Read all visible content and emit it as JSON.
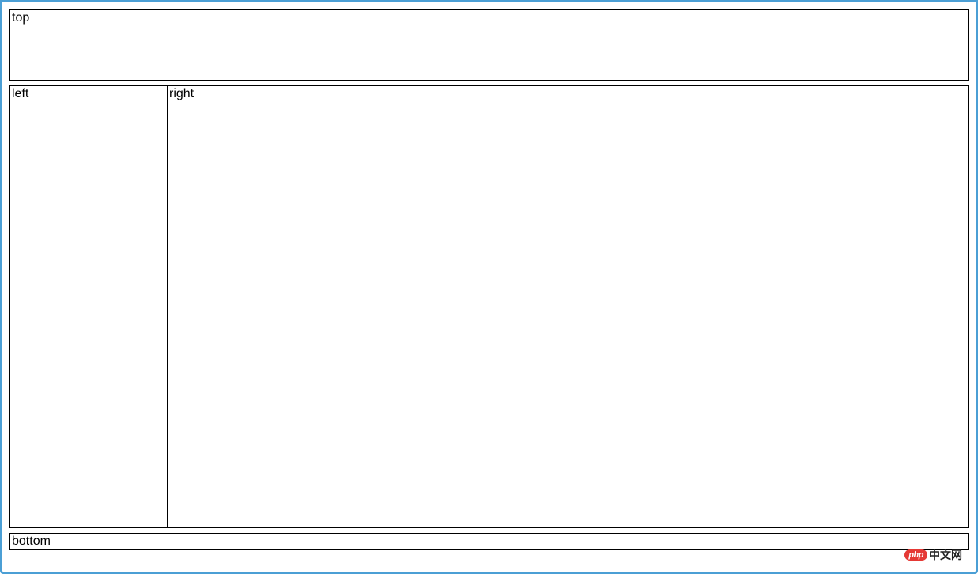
{
  "panels": {
    "top": "top",
    "left": "left",
    "right": "right",
    "bottom": "bottom"
  },
  "watermark": {
    "badge": "php",
    "text": "中文网"
  }
}
